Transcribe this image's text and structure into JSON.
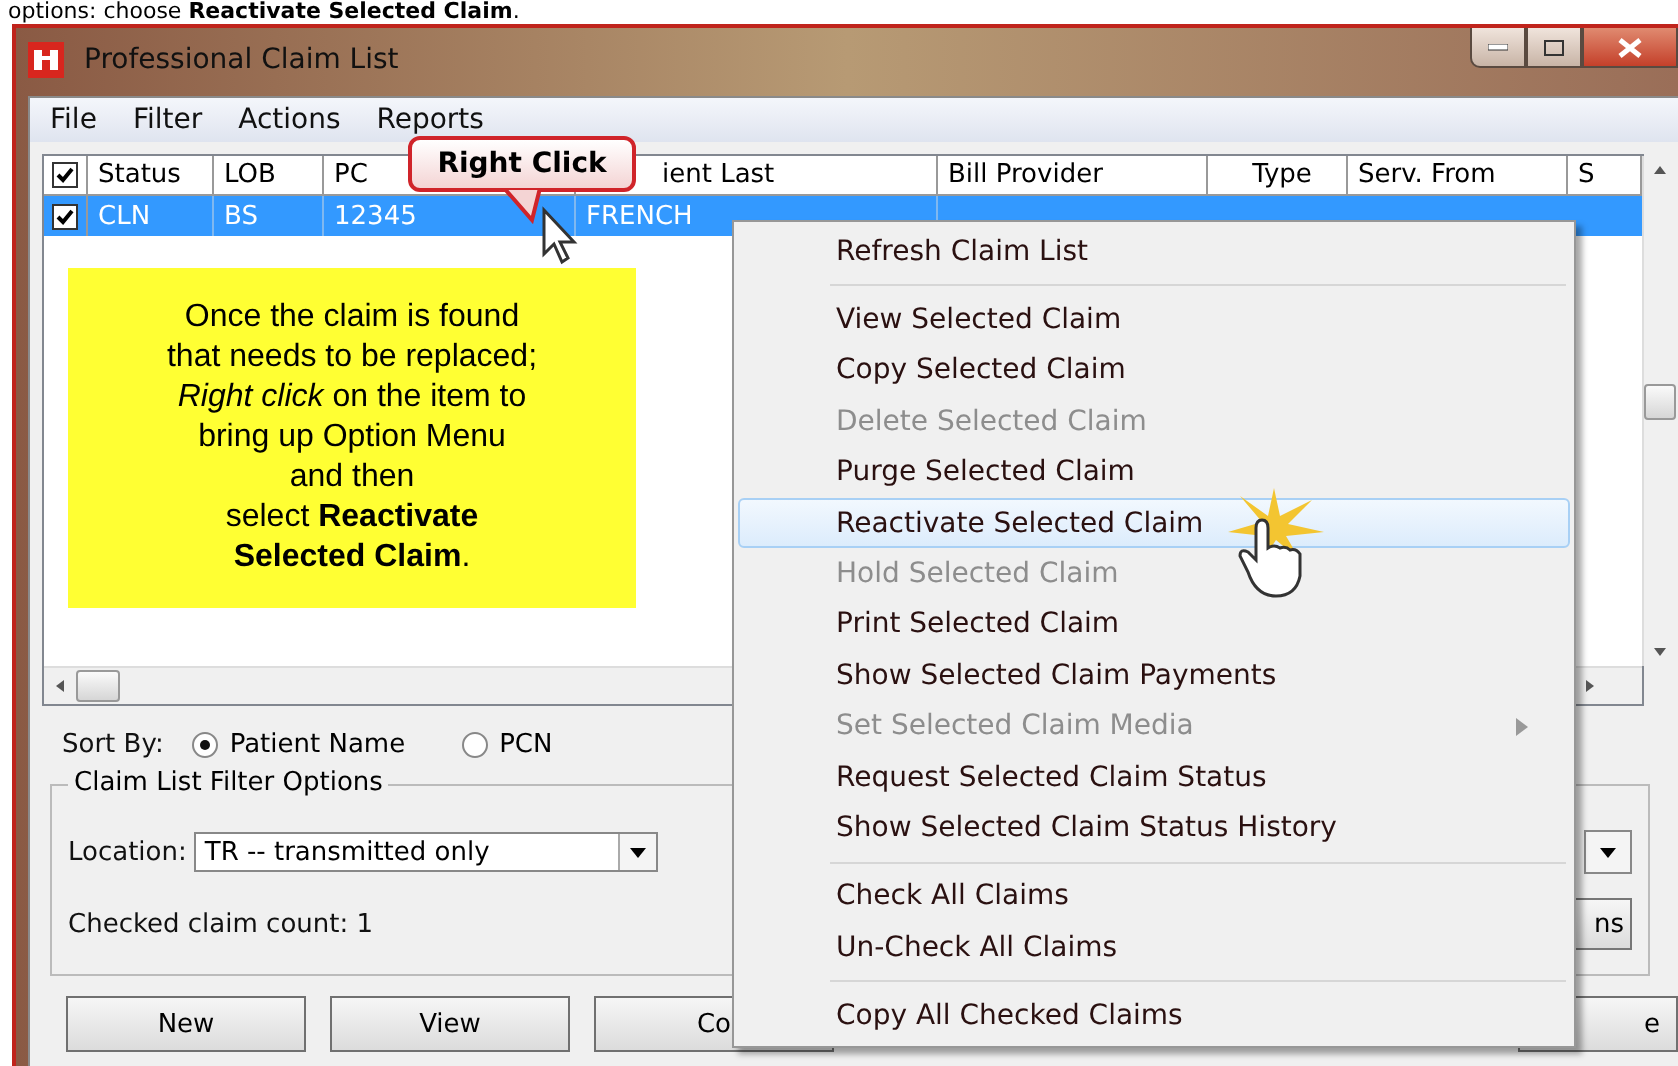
{
  "caption": "options: choose **Reactivate Selected Claim**.",
  "window": {
    "title": "Professional Claim List"
  },
  "menu": [
    "File",
    "Filter",
    "Actions",
    "Reports"
  ],
  "list": {
    "header_checked": true,
    "columns": [
      "Status",
      "LOB",
      "PC",
      "ient Last",
      "Bill Provider",
      "Type",
      "Serv. From",
      "S"
    ],
    "rows": [
      {
        "checked": true,
        "selected": true,
        "cells": [
          "CLN",
          "BS",
          "12345",
          "FRENCH"
        ]
      }
    ]
  },
  "note": [
    "Once  the claim is found",
    "that needs to be replaced;",
    "*Right click* on the item to",
    "bring up Option Menu",
    "and then",
    "select **Reactivate**",
    "**Selected Claim**."
  ],
  "callout": "Right Click",
  "sort": {
    "label": "Sort By:",
    "options": [
      {
        "label": "Patient Name",
        "selected": true
      },
      {
        "label": "PCN",
        "selected": false
      }
    ]
  },
  "filter": {
    "title": "Claim List Filter Options",
    "location_label": "Location:",
    "location_value": "TR -- transmitted only",
    "count": "Checked claim count: 1",
    "side_button": "ns"
  },
  "buttons": [
    "New",
    "View",
    "Co",
    "e"
  ],
  "context_menu": [
    {
      "kind": "item",
      "label": "Refresh Claim List",
      "disabled": false,
      "selected": false
    },
    {
      "kind": "separator"
    },
    {
      "kind": "item",
      "label": "View Selected Claim",
      "disabled": false,
      "selected": false
    },
    {
      "kind": "item",
      "label": "Copy Selected Claim",
      "disabled": false,
      "selected": false
    },
    {
      "kind": "item",
      "label": "Delete Selected Claim",
      "disabled": true,
      "selected": false
    },
    {
      "kind": "item",
      "label": "Purge Selected Claim",
      "disabled": false,
      "selected": false
    },
    {
      "kind": "item",
      "label": "Reactivate Selected Claim",
      "disabled": false,
      "selected": true
    },
    {
      "kind": "item",
      "label": "Hold Selected Claim",
      "disabled": true,
      "selected": false
    },
    {
      "kind": "item",
      "label": "Print Selected Claim",
      "disabled": false,
      "selected": false
    },
    {
      "kind": "item",
      "label": "Show Selected Claim Payments",
      "disabled": false,
      "selected": false
    },
    {
      "kind": "submenu",
      "label": "Set Selected Claim Media",
      "disabled": true,
      "selected": false
    },
    {
      "kind": "item",
      "label": "Request Selected Claim Status",
      "disabled": false,
      "selected": false
    },
    {
      "kind": "item",
      "label": "Show Selected Claim Status History",
      "disabled": false,
      "selected": false
    },
    {
      "kind": "separator"
    },
    {
      "kind": "item",
      "label": "Check All Claims",
      "disabled": false,
      "selected": false
    },
    {
      "kind": "item",
      "label": "Un-Check All Claims",
      "disabled": false,
      "selected": false
    },
    {
      "kind": "separator"
    },
    {
      "kind": "item",
      "label": "Copy All Checked Claims",
      "disabled": false,
      "selected": false
    }
  ]
}
